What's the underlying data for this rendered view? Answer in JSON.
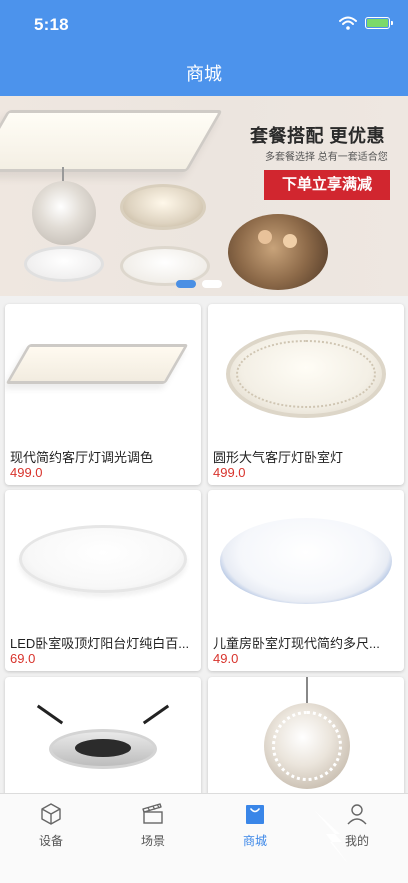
{
  "status": {
    "time": "5:18"
  },
  "header": {
    "title": "商城"
  },
  "banner": {
    "headline": "套餐搭配 更优惠",
    "subtitle": "多套餐选择 总有一套适合您",
    "cta": "下单立享满减",
    "pages": 2,
    "active_page": 1
  },
  "products": [
    {
      "name": "现代简约客厅灯调光调色",
      "price": "499.0",
      "image": "square-ceiling-panel-lamp"
    },
    {
      "name": "圆形大气客厅灯卧室灯",
      "price": "499.0",
      "image": "round-crystal-ceiling-lamp"
    },
    {
      "name": "LED卧室吸顶灯阳台灯纯白百...",
      "price": "69.0",
      "image": "white-round-ceiling-lamp"
    },
    {
      "name": "儿童房卧室灯现代简约多尺...",
      "price": "49.0",
      "image": "blue-rim-ceiling-lamp"
    },
    {
      "name": "",
      "price": "",
      "image": "recessed-spotlight"
    },
    {
      "name": "",
      "price": "",
      "image": "crystal-pendant-globe"
    }
  ],
  "tabbar": {
    "items": [
      {
        "label": "设备",
        "icon": "cube-icon"
      },
      {
        "label": "场景",
        "icon": "clapperboard-icon"
      },
      {
        "label": "商城",
        "icon": "shopping-bag-icon"
      },
      {
        "label": "我的",
        "icon": "user-icon"
      }
    ],
    "active_index": 2
  },
  "colors": {
    "header": "#4c93ec",
    "price": "#d8332c",
    "banner_button": "#d1262f",
    "tab_active": "#3a86e8"
  }
}
